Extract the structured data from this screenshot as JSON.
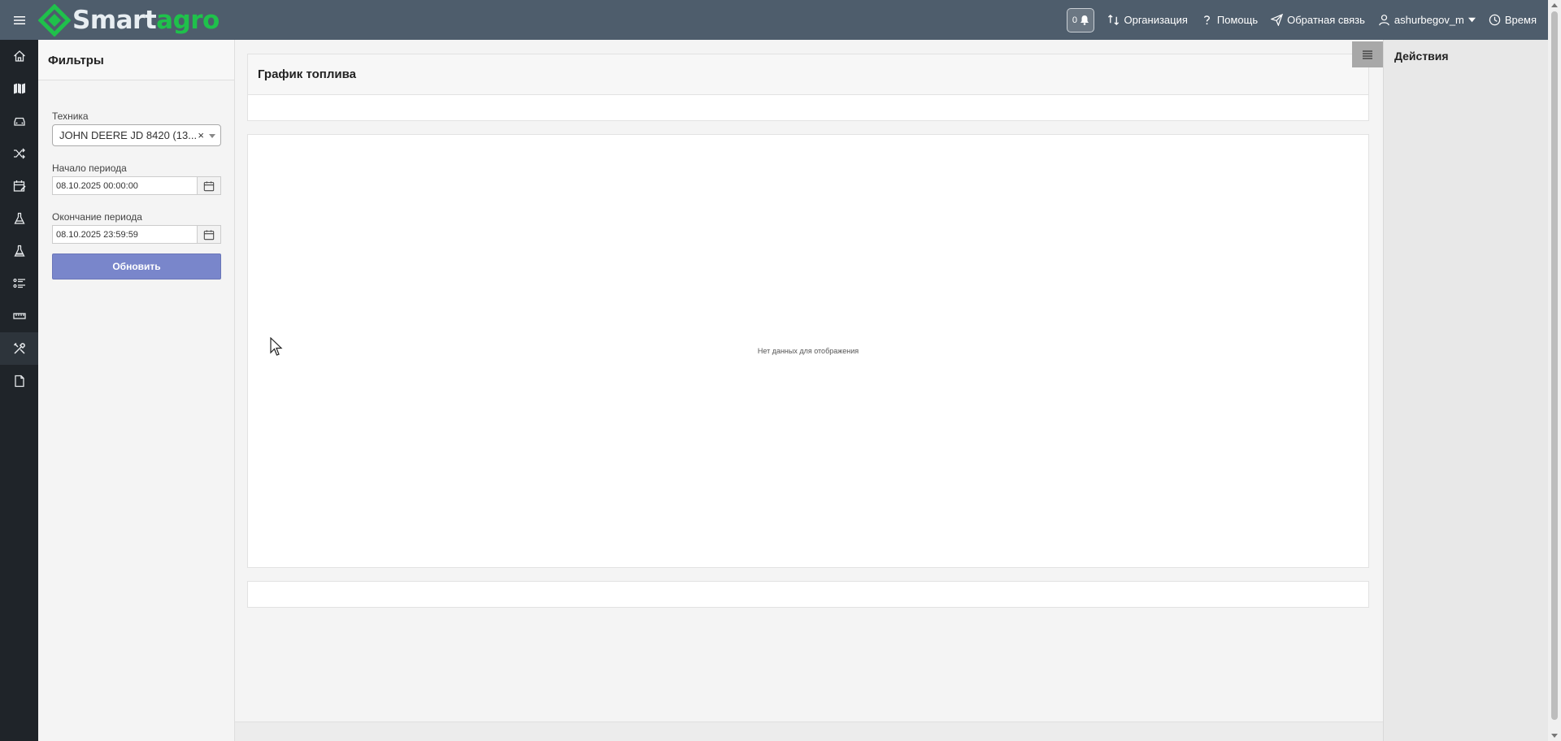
{
  "header": {
    "logo_part1": "Smart",
    "logo_part2": "agro",
    "notifications_count": "0",
    "links": {
      "organization": "Организация",
      "help": "Помощь",
      "feedback": "Обратная связь",
      "user": "ashurbegov_m",
      "time": "Время"
    },
    "brand_color": "#1fc14b",
    "bar_color": "#4e5d6c"
  },
  "rail": {
    "icons": [
      "home-icon",
      "map-icon",
      "car-icon",
      "shuffle-icon",
      "calendar-edit-icon",
      "flask-icon",
      "flask-alt-icon",
      "list-icon",
      "ruler-icon",
      "tools-icon",
      "document-icon"
    ],
    "active": "tools-icon"
  },
  "filters": {
    "title": "Фильтры",
    "vehicle_label": "Техника",
    "vehicle_value": "JOHN DEERE JD 8420 (13...",
    "clear_symbol": "×",
    "start_label": "Начало периода",
    "start_value": "08.10.2025 00:00:00",
    "end_label": "Окончание периода",
    "end_value": "08.10.2025 23:59:59",
    "refresh_label": "Обновить",
    "button_color": "#7986cb"
  },
  "main": {
    "title": "График топлива",
    "empty_message": "Нет данных для отображения"
  },
  "actions": {
    "title": "Действия"
  }
}
